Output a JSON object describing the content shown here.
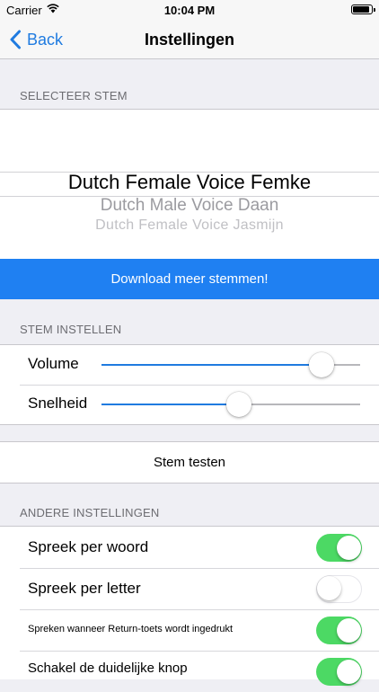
{
  "status_bar": {
    "carrier": "Carrier",
    "time": "10:04 PM"
  },
  "nav": {
    "back_label": "Back",
    "title": "Instellingen"
  },
  "voice_section": {
    "header": "SELECTEER STEM",
    "options": [
      "Dutch Female Voice Femke",
      "Dutch Male Voice Daan",
      "Dutch Female Voice Jasmijn"
    ],
    "selected": "Dutch Female Voice Femke"
  },
  "download_button": "Download meer stemmen!",
  "voice_settings": {
    "header": "STEM INSTELLEN",
    "volume": {
      "label": "Volume",
      "value": 0.85
    },
    "speed": {
      "label": "Snelheid",
      "value": 0.53
    }
  },
  "test_button": "Stem testen",
  "other_settings": {
    "header": "ANDERE INSTELLINGEN",
    "items": [
      {
        "label": "Spreek per woord",
        "on": true
      },
      {
        "label": "Spreek per letter",
        "on": false
      },
      {
        "label": "Spreken wanneer Return-toets wordt ingedrukt",
        "on": true
      },
      {
        "label": "Schakel de duidelijke knop",
        "on": true
      }
    ]
  },
  "colors": {
    "accent": "#1f7be0",
    "button_blue": "#1f80f2",
    "switch_on": "#4cd964",
    "background": "#efeff4"
  }
}
